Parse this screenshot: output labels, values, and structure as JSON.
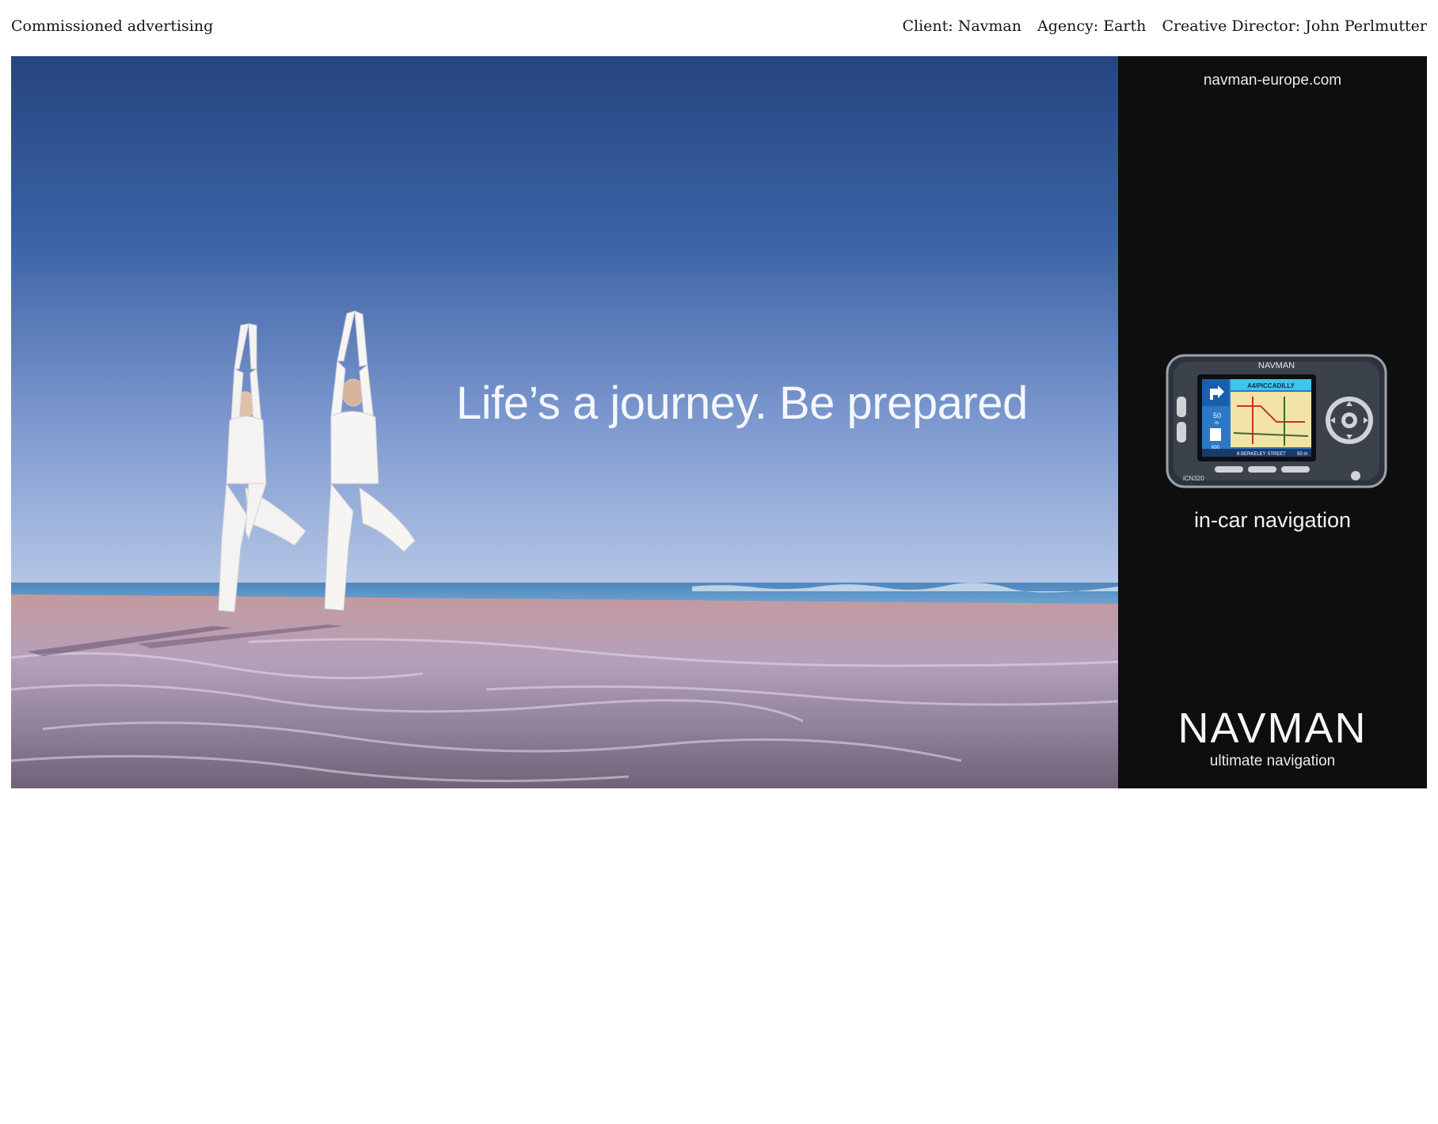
{
  "header": {
    "section": "Commissioned advertising",
    "client": "Client: Navman",
    "agency": "Agency: Earth",
    "creative_director": "Creative Director: John Perlmutter"
  },
  "ad": {
    "tagline": "Life’s a journey. Be prepared",
    "panel": {
      "url": "navman-europe.com",
      "subtitle": "in-car navigation",
      "brand": "NAVMAN",
      "slogan": "ultimate navigation"
    },
    "device": {
      "brand": "NAVMAN",
      "street": "A4/PICCADILLY",
      "distance": "50",
      "distance_unit": "m",
      "distance2": "600",
      "bottom_street": "8 BERKELEY STREET",
      "bottom_distance": "50 m",
      "model": "iCN320"
    }
  },
  "colors": {
    "sky_top": "#2b4d8c",
    "sky_bottom": "#a9bde0",
    "sea": "#6a9ccc",
    "sand": "#b8a0b0",
    "panel_bg": "#0e0e0e"
  }
}
